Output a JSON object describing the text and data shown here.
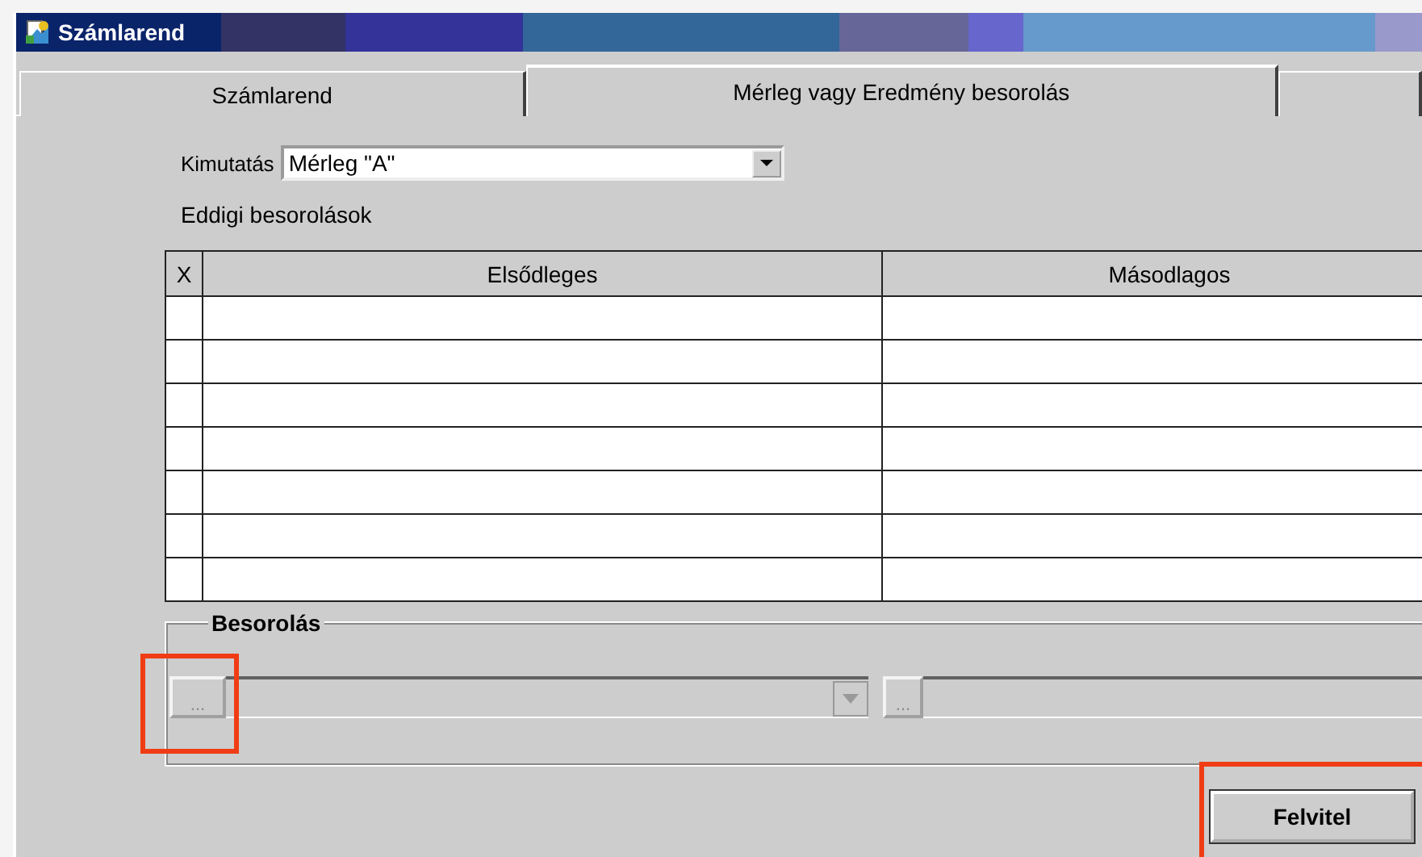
{
  "window": {
    "title": "Számlarend"
  },
  "tabs": [
    {
      "label": "Számlarend",
      "selected": false
    },
    {
      "label": "Mérleg vagy Eredmény besorolás",
      "selected": true
    },
    {
      "selected": false
    }
  ],
  "report": {
    "label": "Kimutatás",
    "value": "Mérleg \"A\""
  },
  "list_title": "Eddigi besorolások",
  "table": {
    "columns": [
      "X",
      "Elsődleges",
      "Másodlagos"
    ]
  },
  "classification": {
    "title": "Besorolás",
    "fields": [
      {
        "kind": "combo",
        "button": "...",
        "disabled": true,
        "highlighted": true
      },
      {
        "kind": "text",
        "button": "...",
        "disabled": true,
        "highlighted": false
      }
    ]
  },
  "buttons": [
    {
      "label": "Felvitel",
      "highlighted": true
    }
  ]
}
